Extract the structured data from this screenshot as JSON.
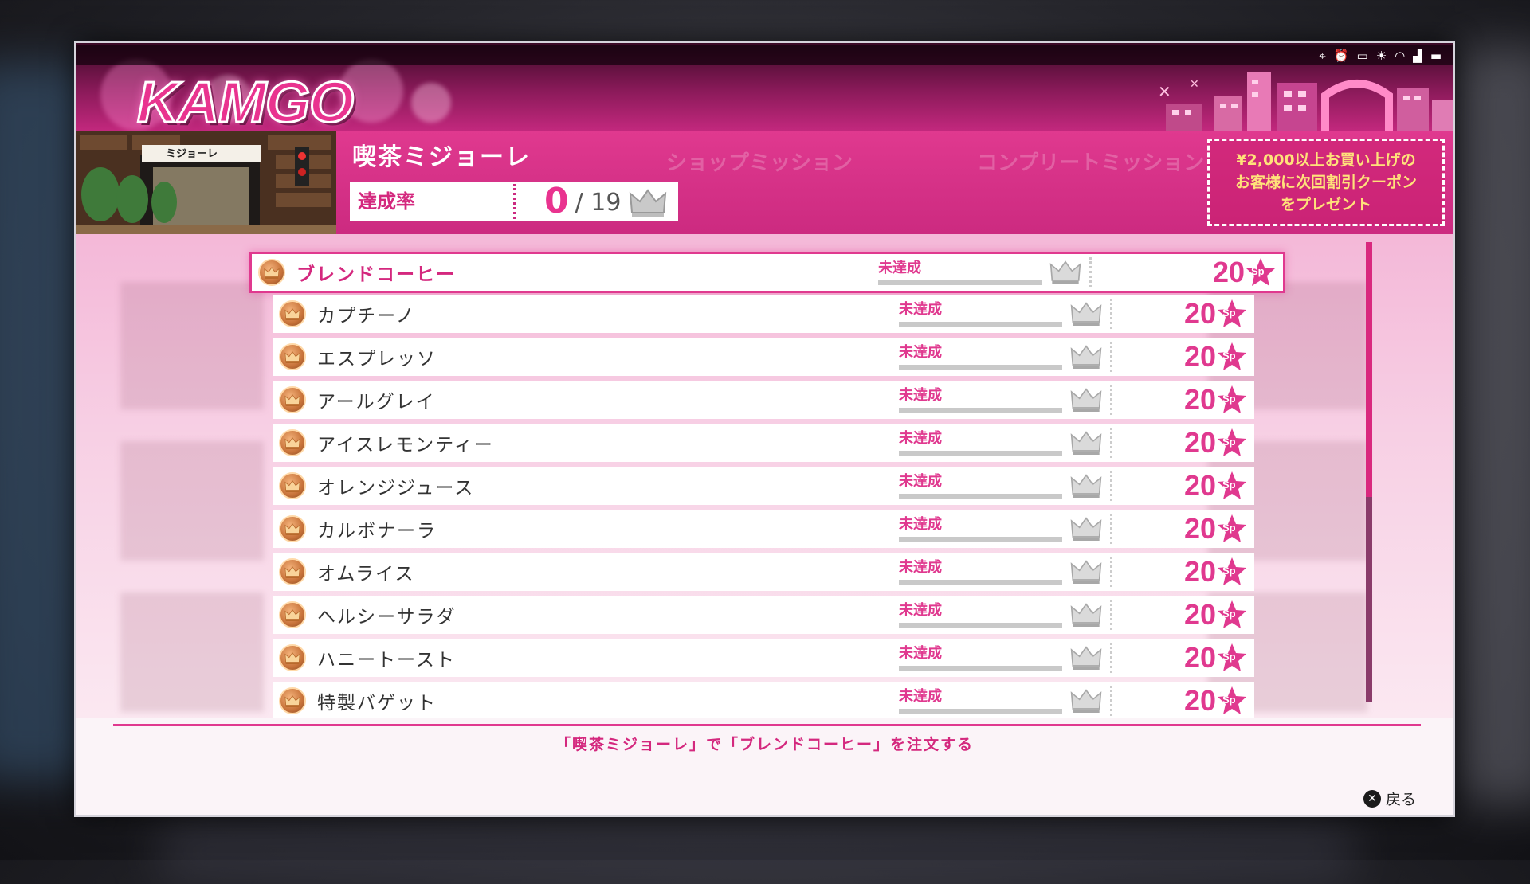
{
  "header": {
    "logo": "KAMGO",
    "status_icons": [
      "location-icon",
      "alarm-icon",
      "voicemail-icon",
      "brightness-icon",
      "wifi-icon",
      "signal-icon",
      "battery-icon"
    ]
  },
  "shop": {
    "name": "喫茶ミジョーレ",
    "sign_text": "ミジョーレ",
    "completion_label": "達成率",
    "completion_value": "0",
    "completion_total": "/ 19",
    "faded_tabs": [
      "ショップミッション",
      "コンプリートミッション"
    ],
    "coupon_lines": [
      "¥2,000以上お買い上げの",
      "お客様に次回割引クーポン",
      "をプレゼント"
    ]
  },
  "missions": [
    {
      "name": "ブレンドコーヒー",
      "status": "未達成",
      "points": "20"
    },
    {
      "name": "カプチーノ",
      "status": "未達成",
      "points": "20"
    },
    {
      "name": "エスプレッソ",
      "status": "未達成",
      "points": "20"
    },
    {
      "name": "アールグレイ",
      "status": "未達成",
      "points": "20"
    },
    {
      "name": "アイスレモンティー",
      "status": "未達成",
      "points": "20"
    },
    {
      "name": "オレンジジュース",
      "status": "未達成",
      "points": "20"
    },
    {
      "name": "カルボナーラ",
      "status": "未達成",
      "points": "20"
    },
    {
      "name": "オムライス",
      "status": "未達成",
      "points": "20"
    },
    {
      "name": "ヘルシーサラダ",
      "status": "未達成",
      "points": "20"
    },
    {
      "name": "ハニートースト",
      "status": "未達成",
      "points": "20"
    },
    {
      "name": "特製バゲット",
      "status": "未達成",
      "points": "20"
    }
  ],
  "sp_label": "Sp",
  "hint": "「喫茶ミジョーレ」で「ブレンドコーヒー」を注文する",
  "back_label": "戻る",
  "back_button_glyph": "✕",
  "colors": {
    "accent": "#e0398f",
    "header_dark": "#3a0a26",
    "coupon_text": "#ffe27a",
    "medal": "#c8733a"
  }
}
